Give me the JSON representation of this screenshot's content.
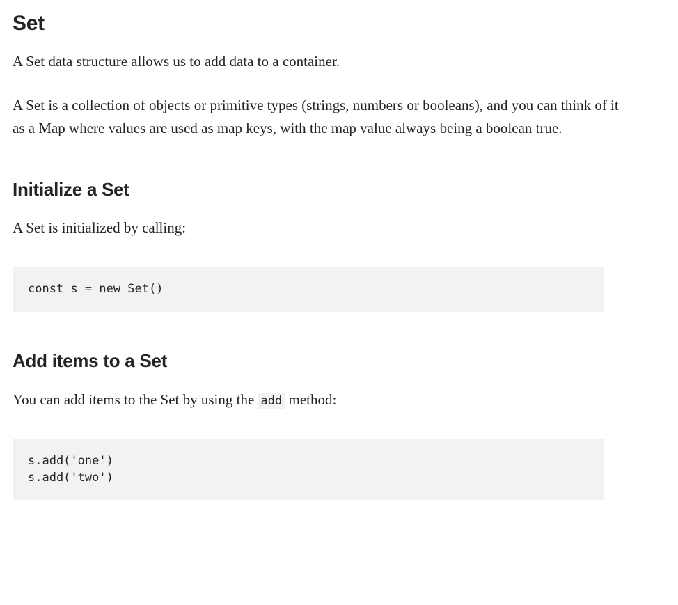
{
  "heading_set": "Set",
  "para_intro": "A Set data structure allows us to add data to a container.",
  "para_desc": "A Set is a collection of objects or primitive types (strings, numbers or booleans), and you can think of it as a Map where values are used as map keys, with the map value always being a boolean true.",
  "heading_init": "Initialize a Set",
  "para_init": "A Set is initialized by calling:",
  "code_init": "const s = new Set()",
  "heading_add": "Add items to a Set",
  "para_add_before": "You can add items to the Set by using the ",
  "para_add_code": "add",
  "para_add_after": " method:",
  "code_add": "s.add('one')\ns.add('two')"
}
